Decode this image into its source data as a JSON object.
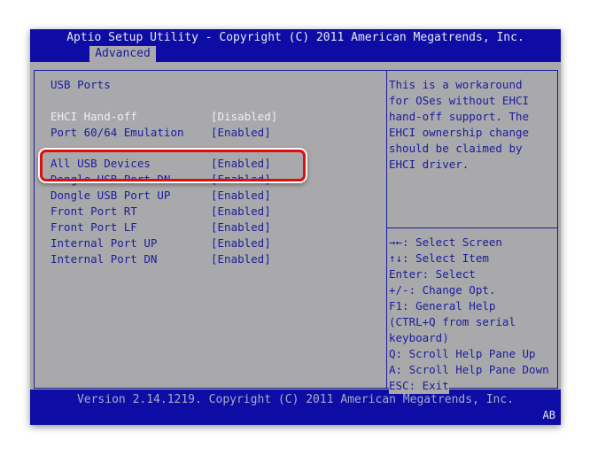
{
  "header": {
    "title": "Aptio Setup Utility - Copyright (C) 2011 American Megatrends, Inc.",
    "tab": "Advanced"
  },
  "main": {
    "section": "USB Ports",
    "items": [
      {
        "label": "EHCI Hand-off",
        "value": "[Disabled]",
        "selected": true
      },
      {
        "label": "Port 60/64 Emulation",
        "value": "[Enabled]"
      },
      {
        "label": "All USB Devices",
        "value": "[Enabled]",
        "highlighted": true
      },
      {
        "label": "Dongle USB Port DN",
        "value": "[Enabled]"
      },
      {
        "label": "Dongle USB Port UP",
        "value": "[Enabled]"
      },
      {
        "label": "Front Port RT",
        "value": "[Enabled]"
      },
      {
        "label": "Front Port LF",
        "value": "[Enabled]"
      },
      {
        "label": "Internal Port UP",
        "value": "[Enabled]"
      },
      {
        "label": "Internal Port DN",
        "value": "[Enabled]"
      }
    ]
  },
  "help": {
    "lines": [
      "This is a workaround",
      "for OSes without EHCI",
      "hand-off support. The",
      "EHCI ownership change",
      "should be claimed by",
      "EHCI driver."
    ]
  },
  "keys": [
    "→←: Select Screen",
    "↑↓: Select Item",
    "Enter: Select",
    "+/-: Change Opt.",
    "F1: General Help",
    "(CTRL+Q from serial",
    "keyboard)",
    "Q: Scroll Help Pane Up",
    "A: Scroll Help Pane Down",
    "ESC: Exit"
  ],
  "footer": {
    "version": "Version 2.14.1219. Copyright (C) 2011 American Megatrends, Inc.",
    "badge": "AB"
  },
  "colors": {
    "bios_blue": "#0d0da6",
    "bios_gray": "#a9a9ab",
    "highlight_red": "#e00d0d"
  }
}
